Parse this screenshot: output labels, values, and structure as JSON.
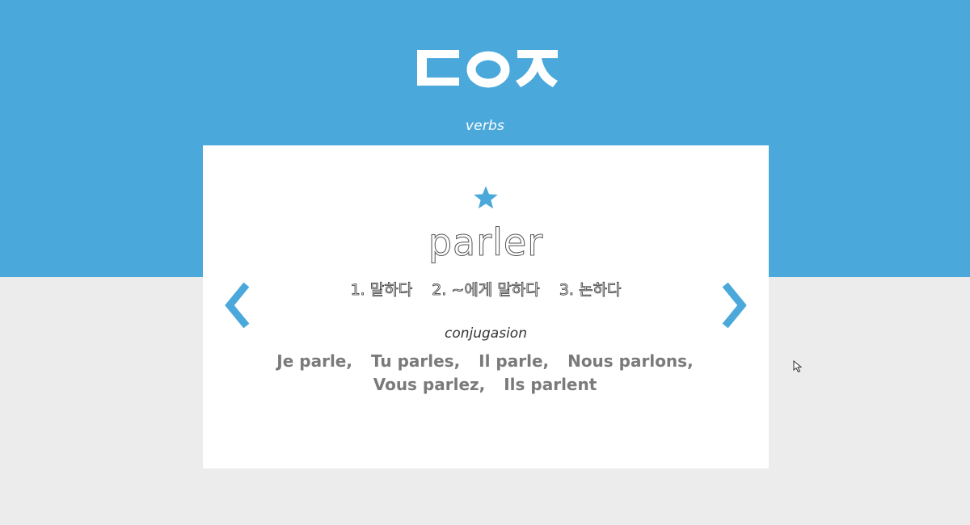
{
  "header": {
    "category": "verbs",
    "logo_text": "ㄷㅇㅈ"
  },
  "card": {
    "favorite_icon": "star-icon",
    "word": "parler",
    "meanings": [
      "1. 말하다",
      "2. ~에게 말하다",
      "3. 논하다"
    ],
    "conjugation_label": "conjugasion",
    "conjugations": [
      "Je parle,",
      "Tu parles,",
      "Il parle,",
      "Nous parlons,",
      "Vous parlez,",
      "Ils parlent"
    ]
  },
  "navigation": {
    "prev_icon": "chevron-left-icon",
    "next_icon": "chevron-right-icon"
  },
  "colors": {
    "accent": "#4aa8da",
    "background": "#ececec",
    "card": "#ffffff",
    "conjugation_text": "#7a7a7a"
  }
}
